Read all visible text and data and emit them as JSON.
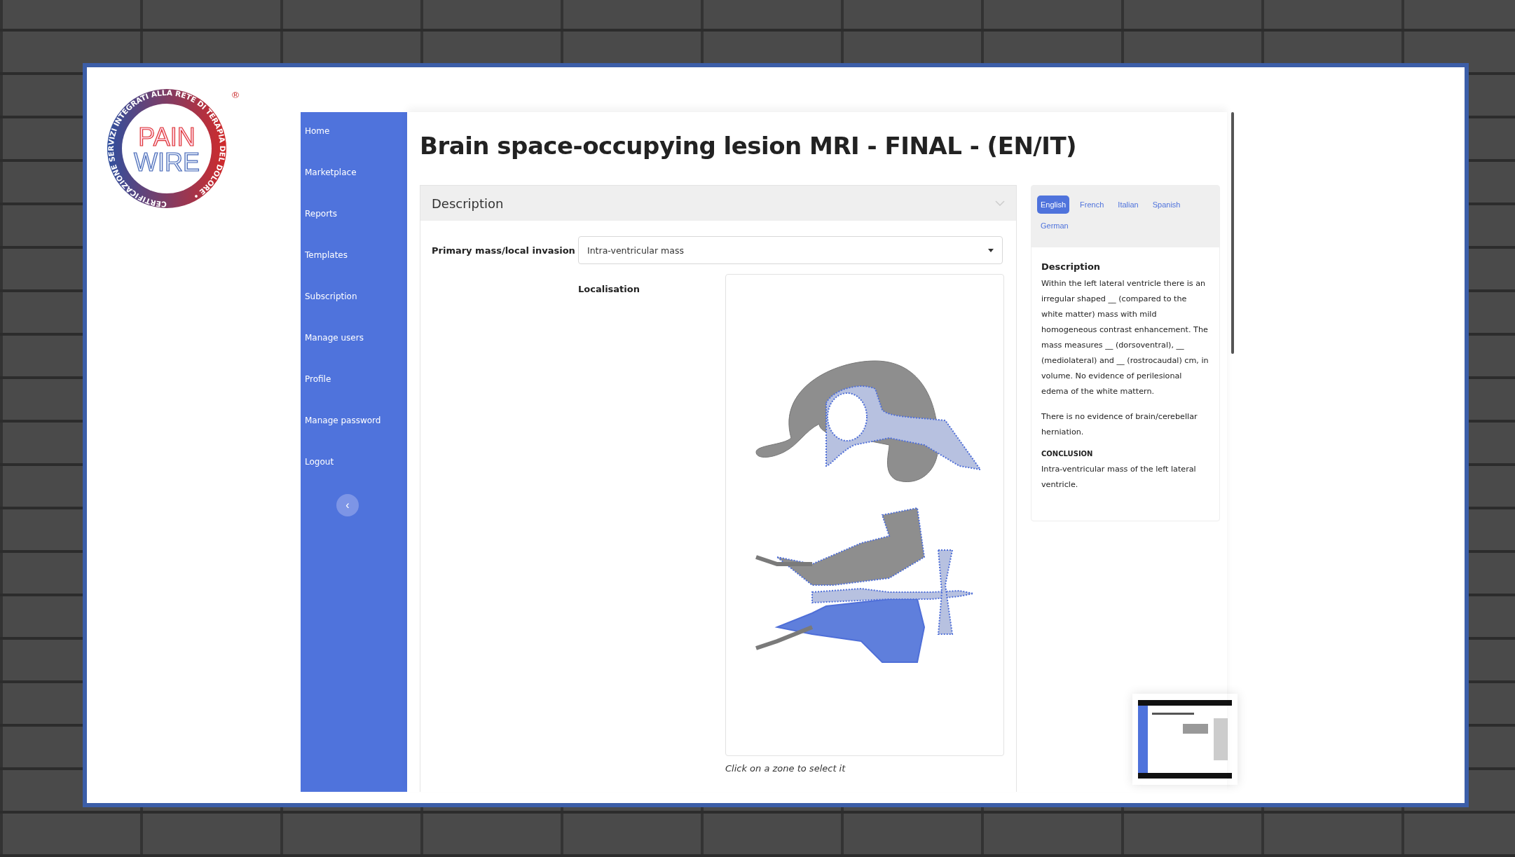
{
  "logo": {
    "ring_text": "CERTIFICAZIONE SERVIZI INTEGRATI ALLA RETE DI TERAPIA DEL DOLORE •",
    "top_word": "PAIN",
    "bottom_word": "WIRE",
    "registered_mark": "®"
  },
  "sidebar": {
    "items": [
      {
        "label": "Home"
      },
      {
        "label": "Marketplace"
      },
      {
        "label": "Reports"
      },
      {
        "label": "Templates"
      },
      {
        "label": "Subscription"
      },
      {
        "label": "Manage users"
      },
      {
        "label": "Profile"
      },
      {
        "label": "Manage password"
      },
      {
        "label": "Logout"
      }
    ],
    "collapse_button": "‹"
  },
  "page_title": "Brain space-occupying lesion MRI - FINAL - (EN/IT)",
  "form": {
    "section_title": "Description",
    "expanded": true,
    "fields": [
      {
        "label": "Primary mass/local invasion",
        "value": "Intra-ventricular mass"
      }
    ],
    "localisation_label": "Localisation",
    "map_caption": "Click on a zone to select it"
  },
  "preview": {
    "tabs": [
      {
        "label": "English",
        "selected": true
      },
      {
        "label": "French",
        "selected": false
      },
      {
        "label": "Italian",
        "selected": false
      },
      {
        "label": "Spanish",
        "selected": false
      },
      {
        "label": "German",
        "selected": false
      }
    ],
    "heading": "Description",
    "paragraphs": [
      "Within the left lateral ventricle there is an irregular shaped __ (compared to the white matter) mass with mild homogeneous contrast enhancement. The mass measures __ (dorsoventral), __ (mediolateral) and __ (rostrocaudal) cm, in volume. No evidence of perilesional edema of the white mattern.",
      "There is no evidence of brain/cerebellar herniation."
    ],
    "conclusion_heading": "CONCLUSION",
    "conclusion": "Intra-ventricular mass of the left lateral ventricle."
  }
}
